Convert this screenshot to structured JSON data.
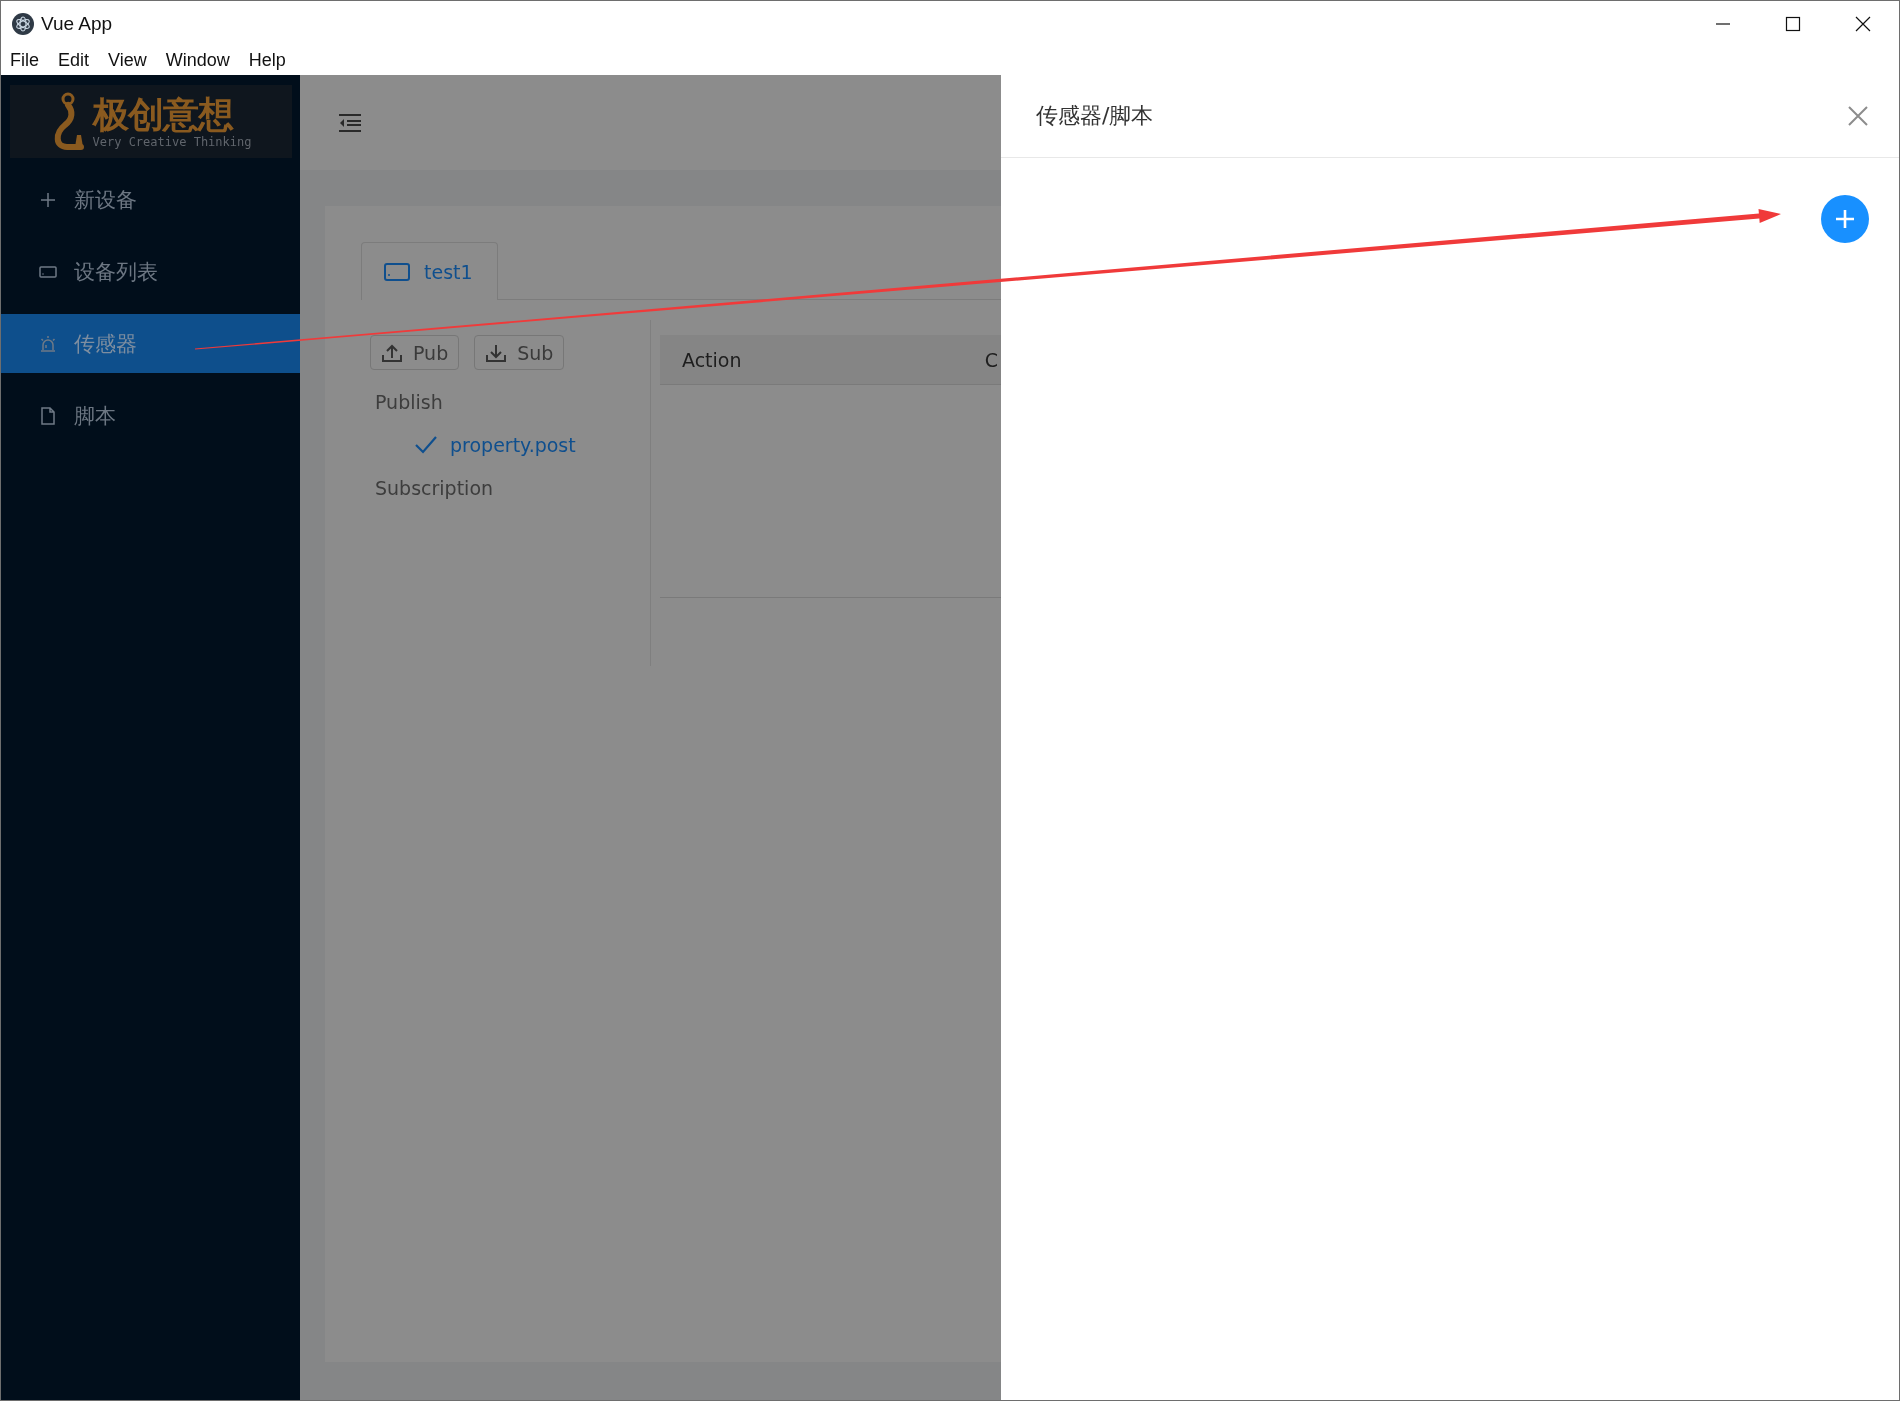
{
  "window": {
    "title": "Vue App"
  },
  "menu_bar": [
    "File",
    "Edit",
    "View",
    "Window",
    "Help"
  ],
  "sidebar": {
    "logo": {
      "title": "极创意想",
      "subtitle": "Very Creative Thinking"
    },
    "items": [
      {
        "label": "新设备",
        "selected": false
      },
      {
        "label": "设备列表",
        "selected": false
      },
      {
        "label": "传感器",
        "selected": true
      },
      {
        "label": "脚本",
        "selected": false
      }
    ]
  },
  "tabs": [
    {
      "label": "test1",
      "selected": true
    }
  ],
  "toolbar_buttons": [
    "Pub",
    "Sub"
  ],
  "topics": [
    {
      "label": "Publish",
      "children": [
        {
          "label": "property.post",
          "checked": true
        }
      ]
    },
    {
      "label": "Subscription"
    }
  ],
  "table": {
    "columns": [
      "Action",
      "C"
    ]
  },
  "drawer": {
    "title": "传感器/脚本"
  }
}
